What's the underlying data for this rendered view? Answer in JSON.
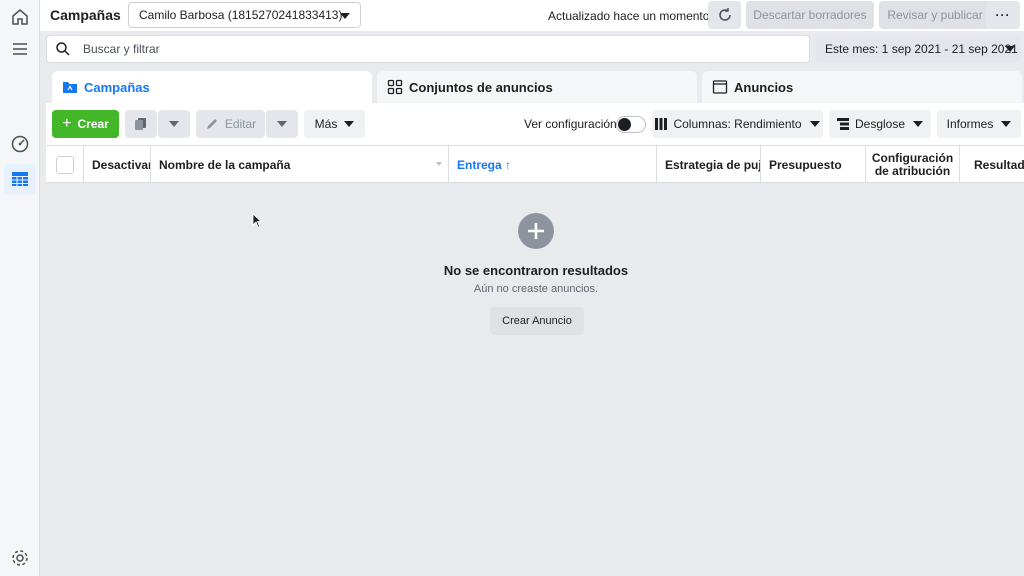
{
  "header": {
    "title": "Campañas",
    "account": "Camilo Barbosa (1815270241833413)",
    "updated": "Actualizado hace un momento",
    "discard_label": "Descartar borradores",
    "publish_label": "Revisar y publicar",
    "more_label": "···"
  },
  "search": {
    "placeholder": "Buscar y filtrar",
    "date_range": "Este mes: 1 sep 2021 - 21 sep 2021"
  },
  "tabs": [
    {
      "label": "Campañas",
      "active": true
    },
    {
      "label": "Conjuntos de anuncios",
      "active": false
    },
    {
      "label": "Anuncios",
      "active": false
    }
  ],
  "toolbar": {
    "create_label": "Crear",
    "edit_label": "Editar",
    "more_label": "Más",
    "view_config_label": "Ver configuración",
    "columns_label": "Columnas: Rendimiento",
    "breakdown_label": "Desglose",
    "reports_label": "Informes"
  },
  "table": {
    "columns": [
      "Desactivar/Activar",
      "Nombre de la campaña",
      "Entrega ↑",
      "Estrategia de puja",
      "Presupuesto",
      "Configuración de atribución",
      "Resultados"
    ]
  },
  "empty_state": {
    "title": "No se encontraron resultados",
    "subtitle": "Aún no creaste anuncios.",
    "button_label": "Crear Anuncio"
  },
  "colors": {
    "accent": "#1877f2",
    "create_green": "#42b72a"
  }
}
